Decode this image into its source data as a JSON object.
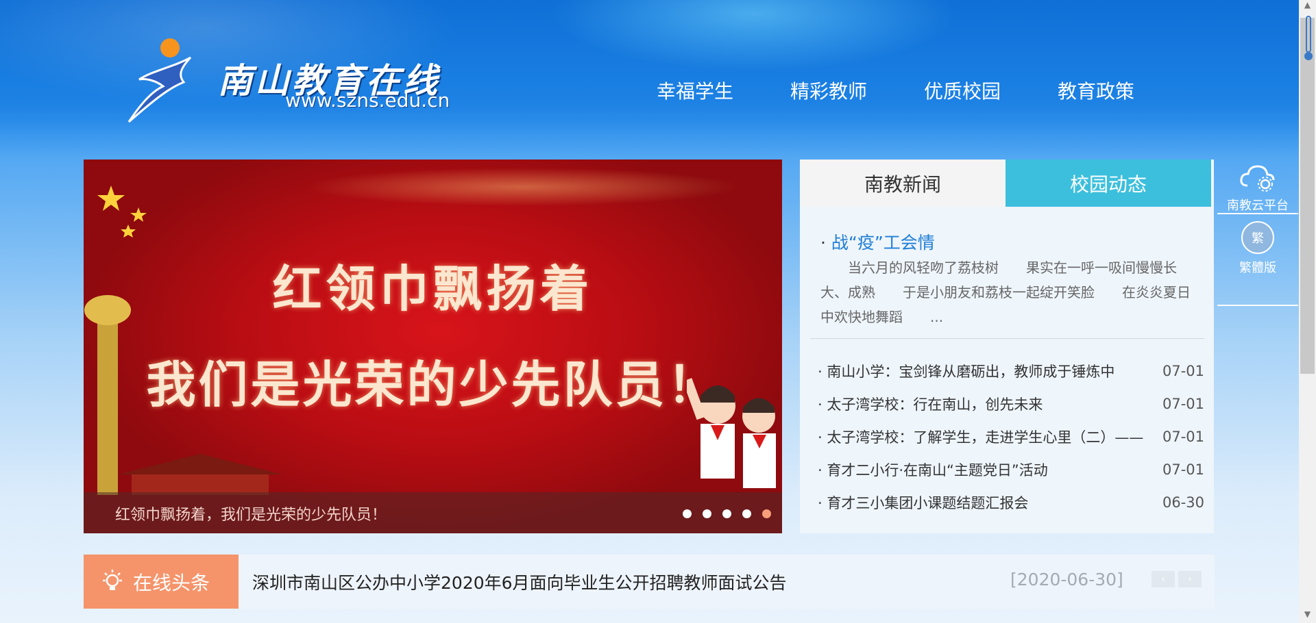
{
  "header": {
    "logo_title": "南山教育在线",
    "logo_url": "www.szns.edu.cn",
    "nav": [
      "幸福学生",
      "精彩教师",
      "优质校园",
      "教育政策"
    ]
  },
  "slider": {
    "headline_line1": "红领巾飘扬着",
    "headline_line2": "我们是光荣的少先队员！",
    "caption": "红领巾飘扬着，我们是光荣的少先队员！",
    "slide_count": 5,
    "active_slide": 5
  },
  "news": {
    "tabs": [
      {
        "label": "南教新闻",
        "active": false
      },
      {
        "label": "校园动态",
        "active": true
      }
    ],
    "feature": {
      "title": "战“疫”工会情",
      "summary": "　　当六月的风轻吻了荔枝树　　果实在一呼一吸间慢慢长大、成熟　　于是小朋友和荔枝一起绽开笑脸　　在炎炎夏日中欢快地舞蹈　　..."
    },
    "items": [
      {
        "title": "南山小学：宝剑锋从磨砺出，教师成于锤炼中",
        "date": "07-01"
      },
      {
        "title": "太子湾学校：行在南山，创先未来",
        "date": "07-01"
      },
      {
        "title": "太子湾学校：了解学生，走进学生心里（二）——",
        "date": "07-01"
      },
      {
        "title": "育才二小行·在南山“主题党日”活动",
        "date": "07-01"
      },
      {
        "title": "育才三小集团小课题结题汇报会",
        "date": "06-30"
      }
    ]
  },
  "side": {
    "cloud_label": "南教云平台",
    "trad_circle": "繁",
    "trad_label": "繁體版"
  },
  "headline": {
    "tag": "在线头条",
    "text": "深圳市南山区公办中小学2020年6月面向毕业生公开招聘教师面试公告",
    "date": "[2020-06-30]",
    "prev": "‹",
    "next": "›"
  },
  "colors": {
    "tab_active": "#3cbfdc",
    "feature_title": "#1f7ed6",
    "headline_tag": "#f5946b",
    "slide_dot_active": "#f6a07a"
  }
}
